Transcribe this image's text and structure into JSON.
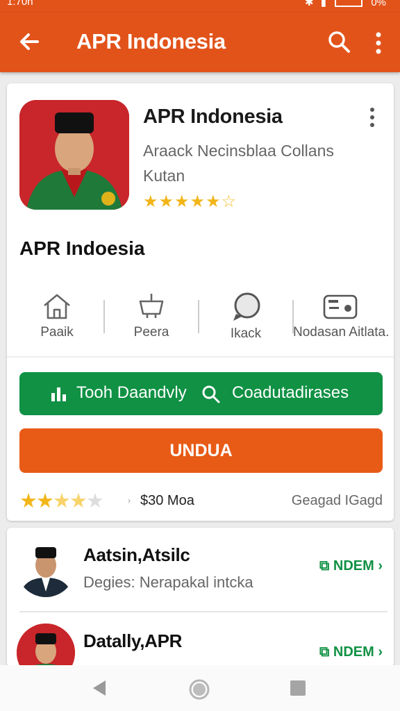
{
  "status_bar": {
    "time": "1:70n",
    "battery": "0%"
  },
  "app_bar": {
    "title": "APR Indonesia"
  },
  "app_card": {
    "title": "APR Indonesia",
    "developer_line1": "Araack Necinsblaa Collans",
    "developer_line2": "Kutan",
    "rating_stars": 4.5,
    "big_name": "APR Indoesia",
    "actions": [
      {
        "icon": "home-icon",
        "label": "Paaik"
      },
      {
        "icon": "basket-icon",
        "label": "Peera"
      },
      {
        "icon": "chat-icon",
        "label": "Ikack"
      },
      {
        "icon": "radio-icon",
        "label": "Nodasan Aitlata."
      }
    ],
    "green_left_label": "Tooh Daandvly",
    "green_right_label": "Coadutadirases",
    "install_label": "UNDUA",
    "bottom_rating_stars": 3.5,
    "price_text": "$30 Moa",
    "right_text": "Geagad IGagd"
  },
  "list": [
    {
      "title": "Aatsin,Atsilc",
      "subtitle": "Degies: Nerapakal intcka",
      "action": "NDEM"
    },
    {
      "title": "Datally,APR",
      "subtitle": "",
      "action": "NDEM"
    }
  ],
  "colors": {
    "primary": "#e2531a",
    "green": "#109144",
    "star": "#f2b61a"
  }
}
